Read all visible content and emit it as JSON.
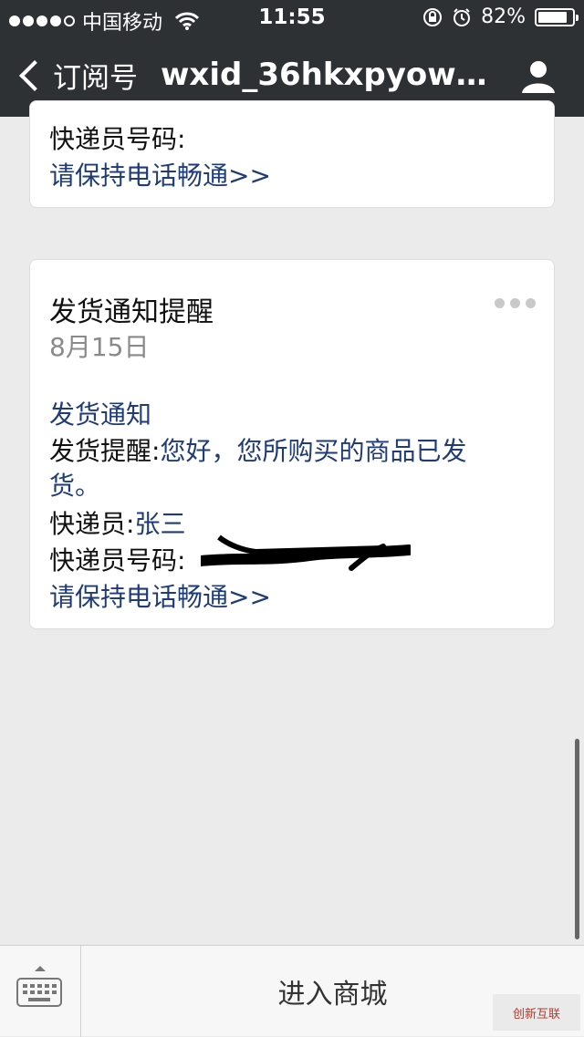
{
  "status_bar": {
    "carrier": "中国移动",
    "time": "11:55",
    "battery": "82%",
    "battery_level": 0.82
  },
  "nav": {
    "back_label": "订阅号",
    "title": "wxid_36hkxpyowh..."
  },
  "cards": [
    {
      "courier_number_label": "快递员号码:",
      "keep_phone_link": "请保持电话畅通>>"
    },
    {
      "title": "发货通知提醒",
      "date": "8月15日",
      "section_title": "发货通知",
      "reminder_label": "发货提醒:",
      "reminder_value_line1": "您好，您所购买的商品已发",
      "reminder_value_line2": "货。",
      "courier_label": "快递员:",
      "courier_value": "张三",
      "courier_number_label": "快递员号码:",
      "keep_phone_link": "请保持电话畅通>>"
    }
  ],
  "bottom_bar": {
    "enter_mall": "进入商城"
  },
  "watermark": "创新互联",
  "icons": [
    "signal-dots-icon",
    "wifi-icon",
    "rotation-lock-icon",
    "alarm-icon",
    "battery-icon",
    "back-chevron-icon",
    "profile-icon",
    "more-dots-icon",
    "keyboard-icon"
  ]
}
